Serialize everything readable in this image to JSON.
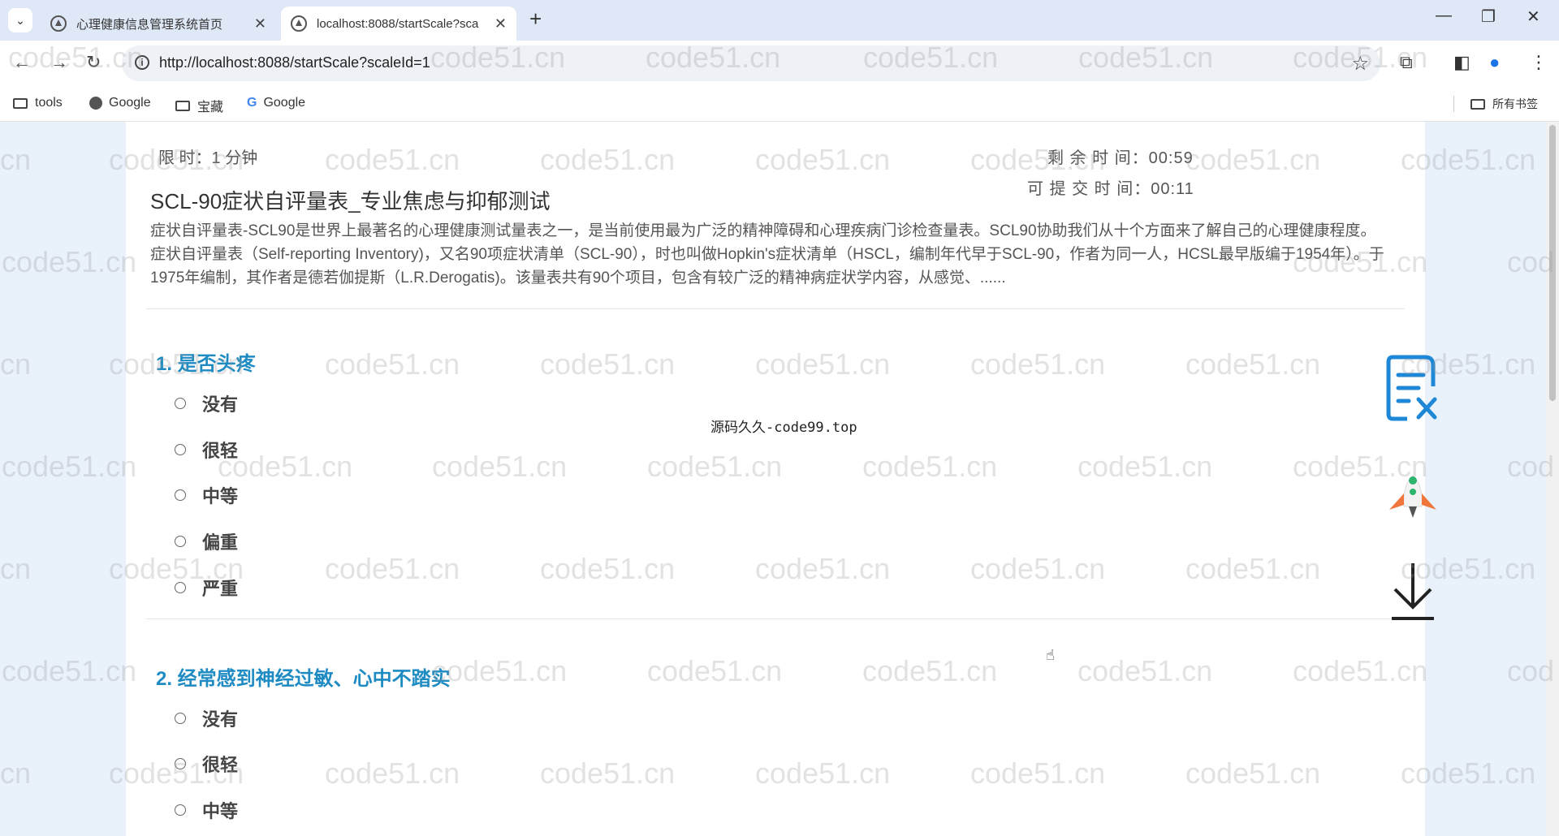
{
  "browser": {
    "tabs": [
      {
        "title": "心理健康信息管理系统首页",
        "active": false
      },
      {
        "title": "localhost:8088/startScale?sca",
        "active": true
      }
    ],
    "url": "http://localhost:8088/startScale?scaleId=1",
    "bookmarks": [
      "tools",
      "Google",
      "宝藏",
      "Google"
    ],
    "all_bookmarks": "所有书签"
  },
  "quiz": {
    "time_limit": "限 时：1 分钟",
    "remaining": "剩 余 时 间：00:59",
    "submittable": "可 提 交 时 间：00:11",
    "title": "SCL-90症状自评量表_专业焦虑与抑郁测试",
    "description": "症状自评量表-SCL90是世界上最著名的心理健康测试量表之一，是当前使用最为广泛的精神障碍和心理疾病门诊检查量表。SCL90协助我们从十个方面来了解自己的心理健康程度。 症状自评量表（Self-reporting Inventory)，又名90项症状清单（SCL-90），时也叫做Hopkin's症状清单（HSCL，编制年代早于SCL-90，作者为同一人，HCSL最早版编于1954年）。于1975年编制，其作者是德若伽提斯（L.R.Derogatis)。该量表共有90个项目，包含有较广泛的精神病症状学内容，从感觉、......",
    "questions": [
      {
        "title": "1. 是否头疼",
        "options": [
          "没有",
          "很轻",
          "中等",
          "偏重",
          "严重"
        ]
      },
      {
        "title": "2. 经常感到神经过敏、心中不踏实",
        "options": [
          "没有",
          "很轻",
          "中等"
        ]
      }
    ]
  },
  "overlay_text": "源码久久-code99.top",
  "watermark_text": "code51.cn",
  "watermark_partial": "cn",
  "watermark_edge": "cod",
  "colors": {
    "accent": "#1e8bc3",
    "page_bg": "#e9f2fb",
    "tab_strip": "#dfe8f6"
  }
}
